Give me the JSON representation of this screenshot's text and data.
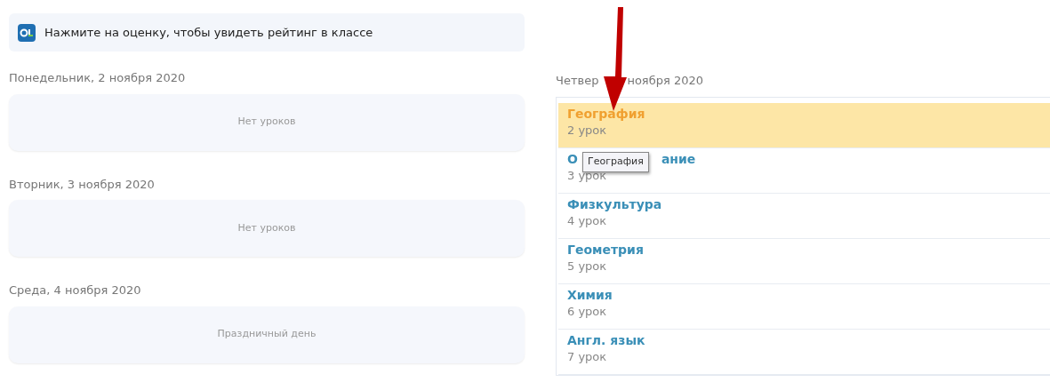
{
  "banner": {
    "text": "Нажмите на оценку, чтобы увидеть рейтинг в классе"
  },
  "days": [
    {
      "date": "Понедельник, 2 ноября 2020",
      "note": "Нет уроков"
    },
    {
      "date": "Вторник, 3 ноября 2020",
      "note": "Нет уроков"
    },
    {
      "date": "Среда, 4 ноября 2020",
      "note": "Праздничный день"
    }
  ],
  "thursday": {
    "date_start": "Четвер",
    "date_end": "ноября 2020",
    "lessons": [
      {
        "title": "География",
        "number": "2 урок",
        "selected": true
      },
      {
        "title": "О",
        "title_continued": "ание",
        "number": "3 урок",
        "selected": false
      },
      {
        "title": "Физкультура",
        "number": "4 урок",
        "selected": false
      },
      {
        "title": "Геометрия",
        "number": "5 урок",
        "selected": false
      },
      {
        "title": "Химия",
        "number": "6 урок",
        "selected": false
      },
      {
        "title": "Англ. язык",
        "number": "7 урок",
        "selected": false
      }
    ]
  },
  "tooltip": {
    "text": "География"
  }
}
